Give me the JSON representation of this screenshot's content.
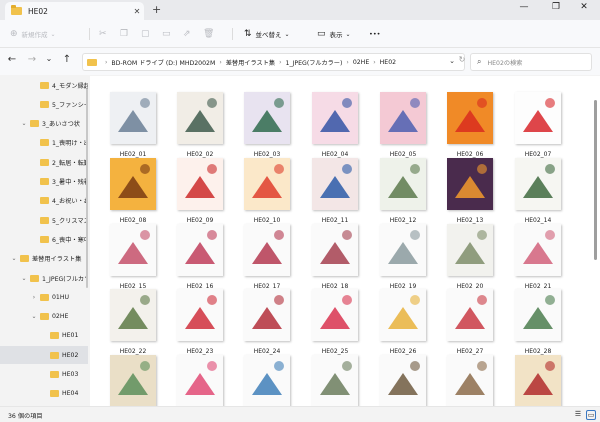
{
  "window": {
    "tab_title": "HE02",
    "tab_close": "✕",
    "new_tab": "+",
    "minimize": "—",
    "maximize": "❐",
    "close": "✕"
  },
  "commands": {
    "new": "新規作成",
    "sort": "並べ替え",
    "view": "表示",
    "more": "•••"
  },
  "nav": {
    "back": "←",
    "forward": "→",
    "recent": "⌄",
    "up": "↑",
    "refresh": "↻",
    "path": [
      "BD-ROM ドライブ (D:) MHD2002M",
      "差替用イラスト集",
      "1_JPEG(フルカラー)",
      "02HE",
      "HE02"
    ],
    "search_placeholder": "HE02の検索"
  },
  "tree": [
    {
      "label": "4_モダン縁起",
      "chevron": "",
      "depth": 2
    },
    {
      "label": "5_ファンシー和",
      "chevron": "",
      "depth": 2
    },
    {
      "label": "3_あいさつ状",
      "chevron": "⌄",
      "depth": 1
    },
    {
      "label": "1_喪明け・出喪",
      "chevron": "",
      "depth": 2
    },
    {
      "label": "2_転居・転勤",
      "chevron": "",
      "depth": 2
    },
    {
      "label": "3_暑中・残暑",
      "chevron": "",
      "depth": 2
    },
    {
      "label": "4_お祝い・お",
      "chevron": "",
      "depth": 2
    },
    {
      "label": "5_クリスマス・",
      "chevron": "",
      "depth": 2
    },
    {
      "label": "6_喪中・寒中",
      "chevron": "",
      "depth": 2
    },
    {
      "label": "差替用イラスト集",
      "chevron": "⌄",
      "depth": 0
    },
    {
      "label": "1_JPEG(フルカラ",
      "chevron": "⌄",
      "depth": 1
    },
    {
      "label": "01HU",
      "chevron": "›",
      "depth": 2
    },
    {
      "label": "02HE",
      "chevron": "⌄",
      "depth": 2
    },
    {
      "label": "HE01",
      "chevron": "",
      "depth": 3
    },
    {
      "label": "HE02",
      "chevron": "",
      "depth": 3,
      "selected": true
    },
    {
      "label": "HE03",
      "chevron": "",
      "depth": 3
    },
    {
      "label": "HE04",
      "chevron": "",
      "depth": 3
    }
  ],
  "files": [
    {
      "name": "HE02_01",
      "icon": "mount-fuji-landscape-icon",
      "bg": "#eef0f3",
      "fg": "#6a7f95"
    },
    {
      "name": "HE02_02",
      "icon": "fuji-ink-painting-icon",
      "bg": "#f1ede6",
      "fg": "#3f5a4c"
    },
    {
      "name": "HE02_03",
      "icon": "fuji-pine-icon",
      "bg": "#e8e3f0",
      "fg": "#2f6b4e"
    },
    {
      "name": "HE02_04",
      "icon": "fuji-pink-sky-icon",
      "bg": "#f6dbe6",
      "fg": "#3454a4"
    },
    {
      "name": "HE02_05",
      "icon": "fuji-sunrise-icon",
      "bg": "#f4c9d4",
      "fg": "#4c5fb0"
    },
    {
      "name": "HE02_06",
      "icon": "fuji-red-sky-icon",
      "bg": "#f08a27",
      "fg": "#d92b1f"
    },
    {
      "name": "HE02_07",
      "icon": "fuji-sun-circle-icon",
      "bg": "#fdfdfd",
      "fg": "#d8262a"
    },
    {
      "name": "HE02_08",
      "icon": "golden-sunrise-icon",
      "bg": "#f4b23f",
      "fg": "#7a3b12"
    },
    {
      "name": "HE02_09",
      "icon": "torii-gate-icon",
      "bg": "#fdf1ec",
      "fg": "#cc2b2b"
    },
    {
      "name": "HE02_10",
      "icon": "sun-and-waves-icon",
      "bg": "#fbe8c9",
      "fg": "#df3d2c"
    },
    {
      "name": "HE02_11",
      "icon": "sun-over-wave-icon",
      "bg": "#f3e6e6",
      "fg": "#2a5aa8"
    },
    {
      "name": "HE02_12",
      "icon": "sunrise-village-icon",
      "bg": "#eef2ea",
      "fg": "#5c7a4c"
    },
    {
      "name": "HE02_13",
      "icon": "sunset-couple-icon",
      "bg": "#4a2b4d",
      "fg": "#f39a2d"
    },
    {
      "name": "HE02_14",
      "icon": "pine-branch-icon",
      "bg": "#f6f6f2",
      "fg": "#3f6a40"
    },
    {
      "name": "HE02_15",
      "icon": "plum-bird-icon",
      "bg": "#fafafa",
      "fg": "#c4506a"
    },
    {
      "name": "HE02_16",
      "icon": "plum-branch-bird-icon",
      "bg": "#fafafa",
      "fg": "#c03d5a"
    },
    {
      "name": "HE02_17",
      "icon": "plum-blossom-icon",
      "bg": "#fafafa",
      "fg": "#b43850"
    },
    {
      "name": "HE02_18",
      "icon": "red-plum-icon",
      "bg": "#fafafa",
      "fg": "#a4404f"
    },
    {
      "name": "HE02_19",
      "icon": "white-plum-bird-icon",
      "bg": "#fafafa",
      "fg": "#8a9a9e"
    },
    {
      "name": "HE02_20",
      "icon": "plum-warbler-icon",
      "bg": "#f2f2ee",
      "fg": "#7f8e6a"
    },
    {
      "name": "HE02_21",
      "icon": "plum-green-bird-icon",
      "bg": "#fafafa",
      "fg": "#d1607a"
    },
    {
      "name": "HE02_22",
      "icon": "pine-plum-icon",
      "bg": "#f3f1ec",
      "fg": "#5d7a47"
    },
    {
      "name": "HE02_23",
      "icon": "red-plum-branch-icon",
      "bg": "#fafafa",
      "fg": "#cf2f3c"
    },
    {
      "name": "HE02_24",
      "icon": "plum-pine-bamboo-icon",
      "bg": "#fafafa",
      "fg": "#b32e3a"
    },
    {
      "name": "HE02_25",
      "icon": "camellia-icon",
      "bg": "#fafafa",
      "fg": "#d8334f"
    },
    {
      "name": "HE02_26",
      "icon": "folding-fan-icon",
      "bg": "#fafafa",
      "fg": "#e8b23b"
    },
    {
      "name": "HE02_27",
      "icon": "flower-wreath-icon",
      "bg": "#fafafa",
      "fg": "#c93a44"
    },
    {
      "name": "HE02_28",
      "icon": "pine-bamboo-icon",
      "bg": "#fafafa",
      "fg": "#4b7d4e"
    },
    {
      "name": "",
      "icon": "crane-sun-icon",
      "bg": "#eadfc7",
      "fg": "#5d8f5a"
    },
    {
      "name": "",
      "icon": "pink-flowers-icon",
      "bg": "#fafafa",
      "fg": "#e04a74"
    },
    {
      "name": "",
      "icon": "kingfisher-icon",
      "bg": "#fafafa",
      "fg": "#3f7fb8"
    },
    {
      "name": "",
      "icon": "songbird-icon",
      "bg": "#fafafa",
      "fg": "#6b7d5d"
    },
    {
      "name": "",
      "icon": "sparrow-branch-icon",
      "bg": "#fafafa",
      "fg": "#6f5a3f"
    },
    {
      "name": "",
      "icon": "owls-icon",
      "bg": "#fafafa",
      "fg": "#8c6b4a"
    },
    {
      "name": "",
      "icon": "ukiyoe-figure-icon",
      "bg": "#f2e3c6",
      "fg": "#b22c2c"
    }
  ],
  "status": {
    "count": "36 個の項目"
  }
}
